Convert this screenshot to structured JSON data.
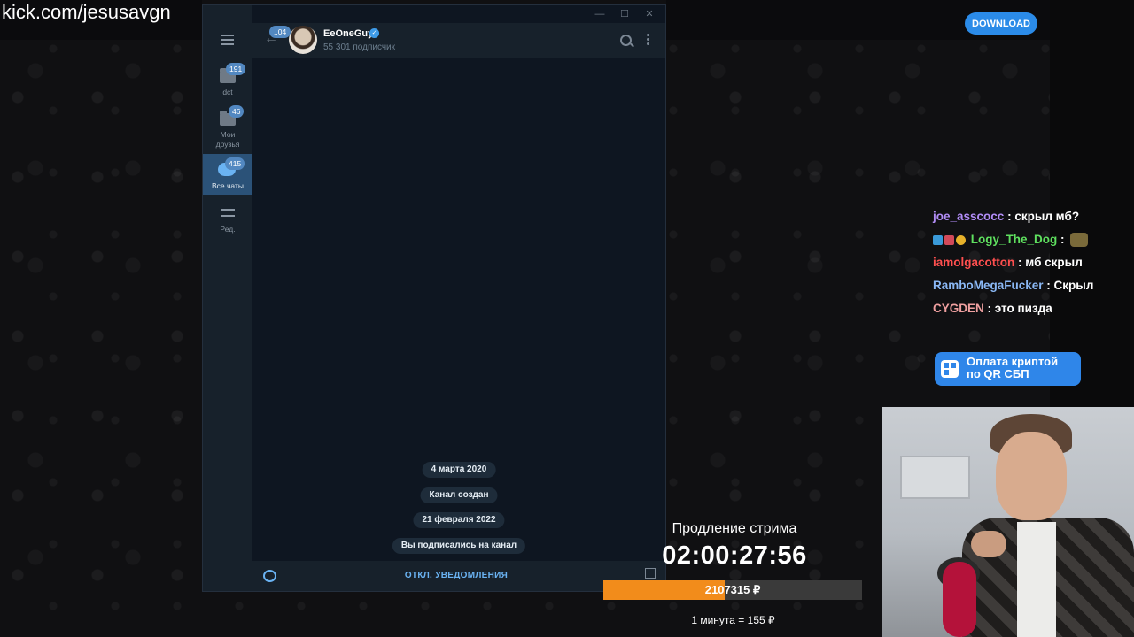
{
  "stream": {
    "url": "kick.com/jesusavgn",
    "download_label": "DOWNLOAD"
  },
  "telegram": {
    "folders": [
      {
        "label": "dct",
        "count": "191"
      },
      {
        "label": "Мои\nдрузья",
        "count": "46"
      },
      {
        "label": "Все чаты",
        "count": "415"
      },
      {
        "label": "Ред.",
        "count": ""
      }
    ],
    "header": {
      "back_badge": "..04",
      "channel_name": "EeOneGuy",
      "subscribers": "55 301 подписчик"
    },
    "service_messages": [
      "4 марта 2020",
      "Канал создан",
      "21 февраля 2022",
      "Вы подписались на канал"
    ],
    "footer": {
      "mute_label": "ОТКЛ. УВЕДОМЛЕНИЯ"
    }
  },
  "chat": {
    "messages": [
      {
        "user": "joe_asscocc",
        "user_color": "#b18cf5",
        "text": "скрыл мб?"
      },
      {
        "user": "Logy_The_Dog",
        "user_color": "#5fe05f",
        "text": ""
      },
      {
        "user": "iamolgacotton",
        "user_color": "#ff4f4f",
        "text": "мб скрыл"
      },
      {
        "user": "RamboMegaFucker",
        "user_color": "#8ab8f5",
        "text": "Скрыл"
      },
      {
        "user": "CYGDEN",
        "user_color": "#f0a0a0",
        "text": "это пизда"
      }
    ],
    "crypto_button": {
      "line1": "Оплата криптой",
      "line2": "по QR СБП"
    }
  },
  "timer": {
    "label": "Продление стрима",
    "value": "02:00:27:56",
    "progress_text": "2107315 ₽",
    "progress_fraction": 0.47,
    "rate": "1 минута = 155 ₽"
  },
  "colors": {
    "accent": "#5288c1",
    "progress": "#f28c1b",
    "download": "#2b8be8"
  }
}
